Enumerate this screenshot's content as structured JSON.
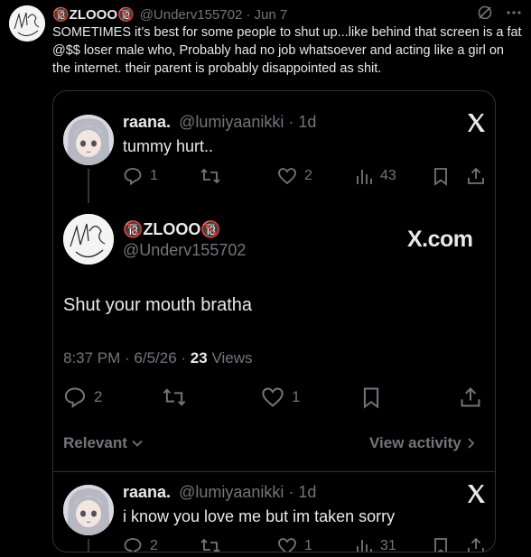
{
  "outer_tweet": {
    "display_name": "🔞ZLOOO🔞",
    "handle": "@Underv155702",
    "date": "· Jun 7",
    "text": "SOMETIMES it’s best for some people to shut up...like behind that screen is a fat @$$ loser male who, Probably had no job whatsoever and acting like a girl on the internet. their parent is probably disappointed as shit."
  },
  "quote": {
    "tweet1": {
      "display_name": "raana.",
      "handle": "@lumiyaanikki",
      "time": "· 1d",
      "text": "tummy hurt..",
      "replies": "1",
      "likes": "2",
      "views": "43"
    },
    "tweet2": {
      "display_name": "🔞ZLOOO🔞",
      "handle": "@Underv155702",
      "brand": "X.com",
      "text": "Shut your mouth bratha",
      "timestamp": "8:37 PM · 6/5/26 · ",
      "views_count": "23",
      "views_label": " Views",
      "replies": "2",
      "likes": "1",
      "relevant_label": "Relevant",
      "view_activity_label": "View activity"
    },
    "tweet3": {
      "display_name": "raana.",
      "handle": "@lumiyaanikki",
      "time": "· 1d",
      "text": "i know you love me but im taken sorry",
      "replies": "2",
      "likes": "1",
      "views": "31"
    }
  }
}
